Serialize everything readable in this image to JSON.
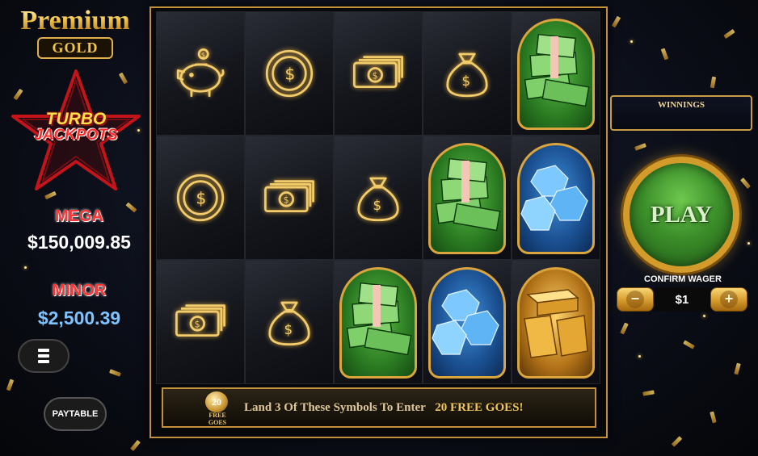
{
  "logo": {
    "title": "Premium",
    "badge": "GOLD"
  },
  "turbo_jackpots": {
    "line1": "TURBO",
    "line2": "JACKPOTS"
  },
  "jackpots": {
    "mega": {
      "label": "MEGA",
      "value": "$150,009.85"
    },
    "minor": {
      "label": "MINOR",
      "value": "$2,500.39"
    }
  },
  "buttons": {
    "menu_icon": "hamburger-icon",
    "paytable": "PAYTABLE"
  },
  "board": {
    "rows": [
      [
        "piggy-bank-outline",
        "coin-outline",
        "banknotes-outline",
        "money-bag-outline",
        "cash-stack"
      ],
      [
        "coin-outline",
        "banknotes-outline",
        "money-bag-outline",
        "cash-stack",
        "diamonds"
      ],
      [
        "banknotes-outline",
        "money-bag-outline",
        "cash-stack",
        "diamonds",
        "gold-bars"
      ]
    ]
  },
  "banner": {
    "coin_number": "20",
    "coin_word_1": "FREE",
    "coin_word_2": "GOES",
    "text": "Land 3 Of These Symbols To Enter",
    "highlight": "20 FREE GOES!"
  },
  "winnings": {
    "label": "WINNINGS"
  },
  "play": {
    "label": "PLAY"
  },
  "wager": {
    "label": "CONFIRM WAGER",
    "value": "$1",
    "minus": "−",
    "plus": "+"
  },
  "colors": {
    "gold": "#d9a53c",
    "green_badge": "#2a7a22",
    "blue_badge": "#1a4f90",
    "gold_badge": "#b37318",
    "mega_value": "#ffffff",
    "minor_value": "#7fc3ff",
    "jackpot_label": "#ff3434"
  }
}
